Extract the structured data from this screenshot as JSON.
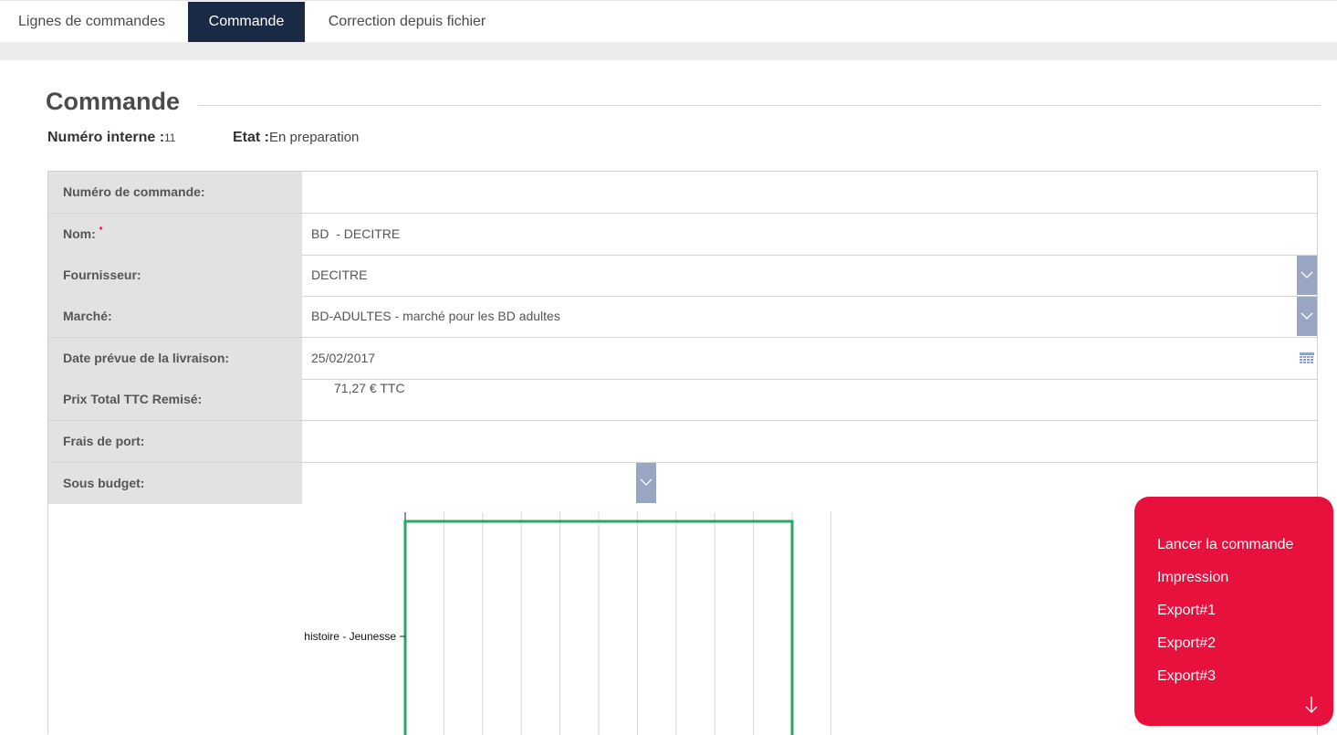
{
  "tabs": [
    {
      "label": "Lignes de commandes",
      "active": false
    },
    {
      "label": "Commande",
      "active": true
    },
    {
      "label": "Correction depuis fichier",
      "active": false
    }
  ],
  "header": {
    "title": "Commande",
    "numero_interne_label": "Numéro interne :",
    "numero_interne_value": "11",
    "etat_label": "Etat :",
    "etat_value": "En preparation"
  },
  "form": {
    "numero_commande": {
      "label": "Numéro de commande:",
      "value": ""
    },
    "nom": {
      "label": "Nom:",
      "required_mark": "*",
      "value": "BD  - DECITRE"
    },
    "fournisseur": {
      "label": "Fournisseur:",
      "value": "DECITRE"
    },
    "marche": {
      "label": "Marché:",
      "value": "BD-ADULTES - marché pour les BD adultes"
    },
    "date_livraison": {
      "label": "Date prévue de la livraison:",
      "value": "25/02/2017"
    },
    "prix_total": {
      "label": "Prix Total TTC Remisé:",
      "value": "71,27 € TTC"
    },
    "frais_port": {
      "label": "Frais de port:",
      "value": ""
    },
    "sous_budget": {
      "label": "Sous budget:",
      "value": ""
    }
  },
  "icons": {
    "dropdown": "chevron-down-icon",
    "calendar": "calendar-icon",
    "scroll_down": "arrow-down-icon"
  },
  "colors": {
    "tab_active_bg": "#1b2a44",
    "action_menu_bg": "#e8113d",
    "dropdown_btn": "#98a6c4",
    "chart_bar_stroke": "#2aa568",
    "required": "#e0113a"
  },
  "actions": [
    {
      "label": "Lancer la commande"
    },
    {
      "label": "Impression"
    },
    {
      "label": "Export#1"
    },
    {
      "label": "Export#2"
    },
    {
      "label": "Export#3"
    }
  ],
  "chart_data": {
    "type": "bar",
    "orientation": "horizontal",
    "categories": [
      "histoire - Jeunesse"
    ],
    "values": [
      10
    ],
    "xlim": [
      0,
      11
    ],
    "grid": true,
    "title": "",
    "xlabel": "",
    "ylabel": ""
  }
}
